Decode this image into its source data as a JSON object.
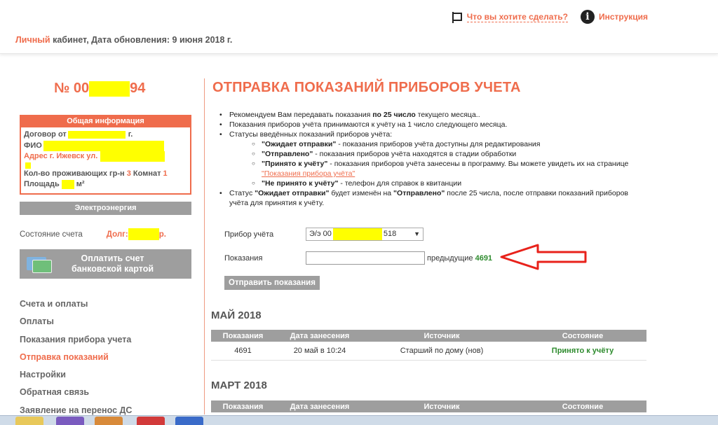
{
  "header": {
    "what_to_do": "Что вы хотите сделать?",
    "instruction": "Инструкция",
    "info_glyph": "i",
    "sub_orange": "Личный",
    "sub_rest": " кабинет, Дата обновления: 9 июня 2018 г."
  },
  "account": {
    "prefix": "№ 00",
    "suffix": "94"
  },
  "general_info": {
    "title": "Общая информация",
    "contract_prefix": "Договор от",
    "contract_suffix": "г.",
    "fio": "ФИО",
    "address": "Адрес г. Ижевск ул.",
    "residents_label": "Кол-во проживающих гр-н",
    "residents_value": "3",
    "rooms_label": "Комнат",
    "rooms_value": "1",
    "area_label": "Площадь",
    "area_unit": "м²"
  },
  "service": "Электроэнергия",
  "state": {
    "label": "Состояние счета",
    "debt_prefix": "Долг:",
    "debt_suffix": "р."
  },
  "pay_button": {
    "line1": "Оплатить счет",
    "line2": "банковской картой"
  },
  "nav": {
    "items": [
      "Счета и оплаты",
      "Оплаты",
      "Показания прибора учета",
      "Отправка показаний",
      "Настройки",
      "Обратная связь",
      "Заявление на перенос ДС"
    ],
    "active_index": 3
  },
  "main": {
    "title": "ОТПРАВКА ПОКАЗАНИЙ ПРИБОРОВ УЧЕТА",
    "b1_pre": "Рекомендуем Вам передавать показания ",
    "b1_bold": "по 25 число",
    "b1_post": " текущего месяца..",
    "b2": "Показания приборов учёта принимаются к учёту на 1 число следующего месяца.",
    "b3": "Статусы введённых показаний приборов учёта:",
    "s1_bold": "\"Ожидает отправки\"",
    "s1_rest": " - показания приборов учёта доступны для редактирования",
    "s2_bold": "\"Отправлено\"",
    "s2_rest": " - показания приборов учёта находятся в стадии обработки",
    "s3_bold": "\"Принято к учёту\"",
    "s3_rest": " - показания приборов учёта занесены в программу. Вы можете увидеть их на странице ",
    "s3_link": "\"Показания прибора учёта\"",
    "s4_bold": "\"Не принято к учёту\"",
    "s4_rest": " - телефон для справок в квитанции",
    "b4_pre": "Статус ",
    "b4_bold1": "\"Ожидает отправки\"",
    "b4_mid": " будет изменён на ",
    "b4_bold2": "\"Отправлено\"",
    "b4_post": " после 25 числа, после отправки показаний приборов учёта для принятия к учёту."
  },
  "form": {
    "meter_label": "Прибор учёта",
    "meter_prefix": "Э/э 00",
    "meter_suffix": "518",
    "meter_arrow": "▼",
    "reading_label": "Показания",
    "reading_value": "",
    "prev_label": "предыдущие",
    "prev_value": "4691",
    "submit": "Отправить показания"
  },
  "table_headers": [
    "Показания",
    "Дата занесения",
    "Источник",
    "Состояние"
  ],
  "months": [
    {
      "title": "МАЙ 2018",
      "rows": [
        {
          "value": "4691",
          "date": "20 май в 10:24",
          "source": "Старший по дому (нов)",
          "status": "Принято к учёту"
        }
      ]
    },
    {
      "title": "МАРТ 2018",
      "rows": []
    }
  ],
  "colors": {
    "accent": "#ef6c4c",
    "gray": "#9e9e9e",
    "ok": "#2e8b2e",
    "redact": "#ffff00",
    "arrow": "#e8221b"
  }
}
